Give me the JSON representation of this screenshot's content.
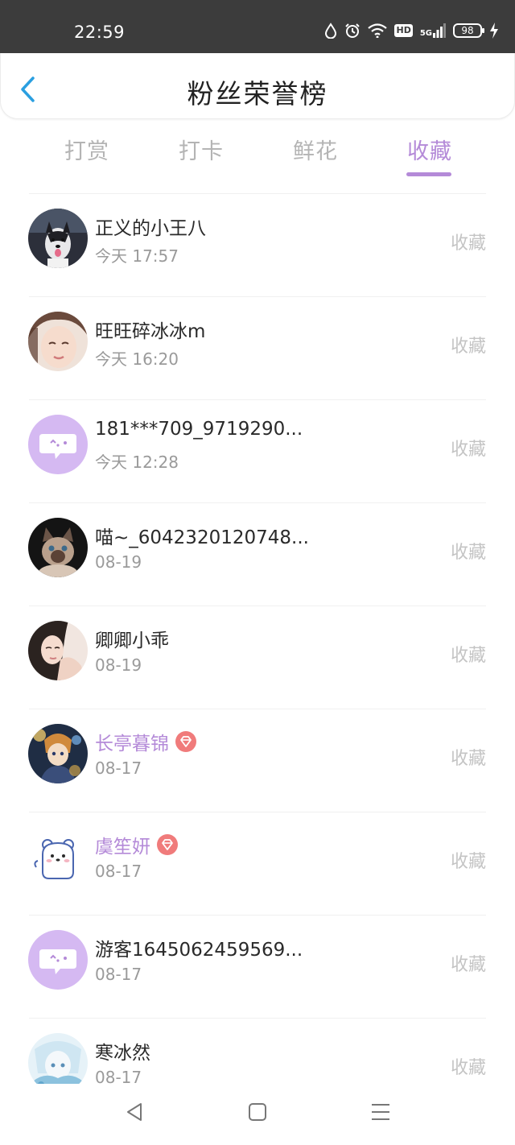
{
  "status_bar": {
    "time": "22:59",
    "battery": "98",
    "hd": "HD",
    "network": "5G"
  },
  "header": {
    "title": "粉丝荣誉榜",
    "back_icon": "chevron-left-icon"
  },
  "tabs": [
    {
      "label": "打赏",
      "active": false
    },
    {
      "label": "打卡",
      "active": false
    },
    {
      "label": "鲜花",
      "active": false
    },
    {
      "label": "收藏",
      "active": true
    }
  ],
  "accent_color": "#b48ad8",
  "fans": [
    {
      "name": "正义的小王八",
      "time": "今天 17:57",
      "action": "收藏",
      "vip": false,
      "avatar": "husky-dog-photo"
    },
    {
      "name": "旺旺碎冰冰m",
      "time": "今天 16:20",
      "action": "收藏",
      "vip": false,
      "avatar": "girl-portrait-photo"
    },
    {
      "name": "181***709_9719290...",
      "time": "今天 12:28",
      "action": "收藏",
      "vip": false,
      "avatar": "default-chat-bubble-avatar"
    },
    {
      "name": "喵~_6042320120748...",
      "time": "08-19",
      "action": "收藏",
      "vip": false,
      "avatar": "cat-photo"
    },
    {
      "name": "卿卿小乖",
      "time": "08-19",
      "action": "收藏",
      "vip": false,
      "avatar": "girl-photo"
    },
    {
      "name": "长亭暮锦",
      "time": "08-17",
      "action": "收藏",
      "vip": true,
      "avatar": "anime-character-avatar"
    },
    {
      "name": "虞笙妍",
      "time": "08-17",
      "action": "收藏",
      "vip": true,
      "avatar": "cartoon-bear-avatar"
    },
    {
      "name": "游客1645062459569...",
      "time": "08-17",
      "action": "收藏",
      "vip": false,
      "avatar": "default-chat-bubble-avatar"
    },
    {
      "name": "寒冰然",
      "time": "08-17",
      "action": "收藏",
      "vip": false,
      "avatar": "blue-anime-avatar"
    }
  ],
  "nav_bar": {
    "back": "triangle-back-icon",
    "home": "square-home-icon",
    "menu": "menu-lines-icon"
  }
}
